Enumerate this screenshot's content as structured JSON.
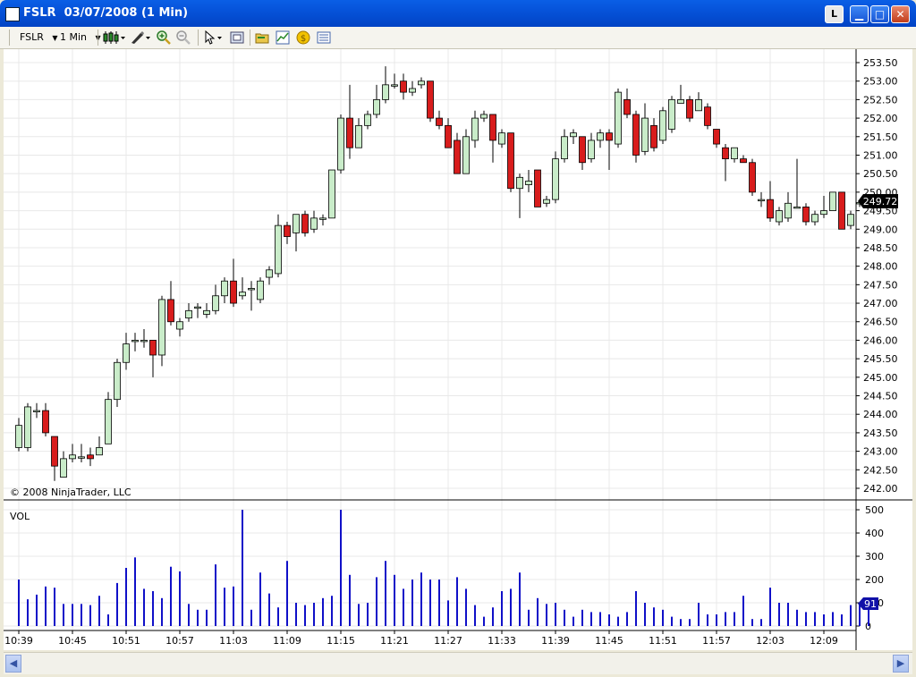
{
  "window": {
    "title": "FSLR  03/07/2008 (1 Min)",
    "link_button": "L"
  },
  "toolbar": {
    "instrument": "FSLR",
    "interval": "1 Min",
    "icons": [
      "candlestick-style-icon",
      "drawing-tool-icon",
      "zoom-in-icon",
      "zoom-out-icon",
      "cursor-icon",
      "data-box-icon",
      "open-folder-icon",
      "indicators-icon",
      "strategy-icon",
      "properties-icon"
    ]
  },
  "chart": {
    "copyright": "© 2008 NinjaTrader, LLC",
    "volume_label": "VOL",
    "last_price": "249.72",
    "last_volume": "91",
    "colors": {
      "up": "#c9ecc9",
      "down": "#d81c1c",
      "volume": "#1010c8",
      "grid": "#e8e8e8",
      "last_price_bg": "#000000",
      "last_volume_bg": "#1010a8"
    }
  },
  "chart_data": [
    {
      "type": "candlestick",
      "title": "FSLR  03/07/2008 (1 Min)",
      "xlabel": "",
      "ylabel": "",
      "ylim": [
        241.8,
        253.7
      ],
      "x_tick_labels": [
        "10:39",
        "10:45",
        "10:51",
        "10:57",
        "11:03",
        "11:09",
        "11:15",
        "11:21",
        "11:27",
        "11:33",
        "11:39",
        "11:45",
        "11:51",
        "11:57",
        "12:03",
        "12:09"
      ],
      "y_tick_labels": [
        "242.00",
        "242.50",
        "243.00",
        "243.50",
        "244.00",
        "244.50",
        "245.00",
        "245.50",
        "246.00",
        "246.50",
        "247.00",
        "247.50",
        "248.00",
        "248.50",
        "249.00",
        "249.50",
        "250.00",
        "250.50",
        "251.00",
        "251.50",
        "252.00",
        "252.50",
        "253.00",
        "253.50"
      ],
      "grid": true,
      "candles": [
        {
          "t": "10:39",
          "o": 243.1,
          "h": 243.9,
          "l": 243.0,
          "c": 243.7
        },
        {
          "t": "10:40",
          "o": 243.1,
          "h": 244.3,
          "l": 243.0,
          "c": 244.2
        },
        {
          "t": "10:41",
          "o": 244.1,
          "h": 244.3,
          "l": 243.9,
          "c": 244.1
        },
        {
          "t": "10:42",
          "o": 244.1,
          "h": 244.3,
          "l": 243.4,
          "c": 243.5
        },
        {
          "t": "10:43",
          "o": 243.4,
          "h": 243.4,
          "l": 242.2,
          "c": 242.6
        },
        {
          "t": "10:44",
          "o": 242.3,
          "h": 243.0,
          "l": 242.3,
          "c": 242.8
        },
        {
          "t": "10:45",
          "o": 242.8,
          "h": 243.2,
          "l": 242.7,
          "c": 242.9
        },
        {
          "t": "10:46",
          "o": 242.85,
          "h": 243.2,
          "l": 242.7,
          "c": 242.85
        },
        {
          "t": "10:47",
          "o": 242.9,
          "h": 243.1,
          "l": 242.6,
          "c": 242.8
        },
        {
          "t": "10:48",
          "o": 242.9,
          "h": 243.4,
          "l": 242.9,
          "c": 243.1
        },
        {
          "t": "10:49",
          "o": 243.2,
          "h": 244.6,
          "l": 243.2,
          "c": 244.4
        },
        {
          "t": "10:50",
          "o": 244.4,
          "h": 245.5,
          "l": 244.2,
          "c": 245.4
        },
        {
          "t": "10:51",
          "o": 245.4,
          "h": 246.2,
          "l": 245.2,
          "c": 245.9
        },
        {
          "t": "10:52",
          "o": 246.0,
          "h": 246.2,
          "l": 245.7,
          "c": 246.0
        },
        {
          "t": "10:53",
          "o": 246.0,
          "h": 246.3,
          "l": 245.8,
          "c": 246.0
        },
        {
          "t": "10:54",
          "o": 246.0,
          "h": 246.0,
          "l": 245.0,
          "c": 245.6
        },
        {
          "t": "10:55",
          "o": 245.6,
          "h": 247.2,
          "l": 245.3,
          "c": 247.1
        },
        {
          "t": "10:56",
          "o": 247.1,
          "h": 247.6,
          "l": 246.4,
          "c": 246.5
        },
        {
          "t": "10:57",
          "o": 246.3,
          "h": 246.6,
          "l": 246.1,
          "c": 246.5
        },
        {
          "t": "10:58",
          "o": 246.6,
          "h": 247.0,
          "l": 246.5,
          "c": 246.8
        },
        {
          "t": "10:59",
          "o": 246.9,
          "h": 247.0,
          "l": 246.6,
          "c": 246.9
        },
        {
          "t": "11:00",
          "o": 246.7,
          "h": 247.0,
          "l": 246.6,
          "c": 246.8
        },
        {
          "t": "11:01",
          "o": 246.8,
          "h": 247.5,
          "l": 246.7,
          "c": 247.2
        },
        {
          "t": "11:02",
          "o": 247.2,
          "h": 247.7,
          "l": 247.0,
          "c": 247.6
        },
        {
          "t": "11:03",
          "o": 247.6,
          "h": 248.2,
          "l": 246.9,
          "c": 247.0
        },
        {
          "t": "11:04",
          "o": 247.2,
          "h": 247.7,
          "l": 247.1,
          "c": 247.3
        },
        {
          "t": "11:05",
          "o": 247.4,
          "h": 247.6,
          "l": 246.8,
          "c": 247.4
        },
        {
          "t": "11:06",
          "o": 247.1,
          "h": 247.7,
          "l": 247.0,
          "c": 247.6
        },
        {
          "t": "11:07",
          "o": 247.7,
          "h": 248.0,
          "l": 247.5,
          "c": 247.9
        },
        {
          "t": "11:08",
          "o": 247.8,
          "h": 249.4,
          "l": 247.7,
          "c": 249.1
        },
        {
          "t": "11:09",
          "o": 249.1,
          "h": 249.2,
          "l": 248.6,
          "c": 248.8
        },
        {
          "t": "11:10",
          "o": 248.9,
          "h": 249.4,
          "l": 248.4,
          "c": 249.4
        },
        {
          "t": "11:11",
          "o": 249.4,
          "h": 249.5,
          "l": 248.8,
          "c": 248.9
        },
        {
          "t": "11:12",
          "o": 249.0,
          "h": 249.5,
          "l": 248.9,
          "c": 249.3
        },
        {
          "t": "11:13",
          "o": 249.3,
          "h": 249.4,
          "l": 249.1,
          "c": 249.3
        },
        {
          "t": "11:14",
          "o": 249.3,
          "h": 250.6,
          "l": 249.3,
          "c": 250.6
        },
        {
          "t": "11:15",
          "o": 250.6,
          "h": 252.1,
          "l": 250.5,
          "c": 252.0
        },
        {
          "t": "11:16",
          "o": 252.0,
          "h": 252.9,
          "l": 250.9,
          "c": 251.2
        },
        {
          "t": "11:17",
          "o": 251.2,
          "h": 252.0,
          "l": 251.2,
          "c": 251.8
        },
        {
          "t": "11:18",
          "o": 251.8,
          "h": 252.2,
          "l": 251.7,
          "c": 252.1
        },
        {
          "t": "11:19",
          "o": 252.1,
          "h": 252.9,
          "l": 252.0,
          "c": 252.5
        },
        {
          "t": "11:20",
          "o": 252.5,
          "h": 253.4,
          "l": 252.4,
          "c": 252.9
        },
        {
          "t": "11:21",
          "o": 252.9,
          "h": 253.2,
          "l": 252.8,
          "c": 252.9
        },
        {
          "t": "11:22",
          "o": 253.0,
          "h": 253.2,
          "l": 252.5,
          "c": 252.7
        },
        {
          "t": "11:23",
          "o": 252.7,
          "h": 253.0,
          "l": 252.6,
          "c": 252.8
        },
        {
          "t": "11:24",
          "o": 252.9,
          "h": 253.1,
          "l": 252.8,
          "c": 253.0
        },
        {
          "t": "11:25",
          "o": 253.0,
          "h": 253.0,
          "l": 251.9,
          "c": 252.0
        },
        {
          "t": "11:26",
          "o": 252.0,
          "h": 252.2,
          "l": 251.7,
          "c": 251.8
        },
        {
          "t": "11:27",
          "o": 251.8,
          "h": 252.0,
          "l": 251.2,
          "c": 251.2
        },
        {
          "t": "11:28",
          "o": 251.4,
          "h": 251.6,
          "l": 250.5,
          "c": 250.5
        },
        {
          "t": "11:29",
          "o": 250.5,
          "h": 251.7,
          "l": 250.5,
          "c": 251.5
        },
        {
          "t": "11:30",
          "o": 251.4,
          "h": 252.2,
          "l": 251.2,
          "c": 252.0
        },
        {
          "t": "11:31",
          "o": 252.0,
          "h": 252.2,
          "l": 251.9,
          "c": 252.1
        },
        {
          "t": "11:32",
          "o": 252.1,
          "h": 252.1,
          "l": 250.8,
          "c": 251.4
        },
        {
          "t": "11:33",
          "o": 251.3,
          "h": 251.7,
          "l": 251.2,
          "c": 251.6
        },
        {
          "t": "11:34",
          "o": 251.6,
          "h": 251.6,
          "l": 250.0,
          "c": 250.1
        },
        {
          "t": "11:35",
          "o": 250.1,
          "h": 250.5,
          "l": 249.3,
          "c": 250.4
        },
        {
          "t": "11:36",
          "o": 250.2,
          "h": 250.6,
          "l": 250.0,
          "c": 250.3
        },
        {
          "t": "11:37",
          "o": 250.6,
          "h": 250.6,
          "l": 249.6,
          "c": 249.6
        },
        {
          "t": "11:38",
          "o": 249.7,
          "h": 249.9,
          "l": 249.6,
          "c": 249.8
        },
        {
          "t": "11:39",
          "o": 249.8,
          "h": 251.1,
          "l": 249.7,
          "c": 250.9
        },
        {
          "t": "11:40",
          "o": 250.9,
          "h": 251.7,
          "l": 250.8,
          "c": 251.5
        },
        {
          "t": "11:41",
          "o": 251.5,
          "h": 251.7,
          "l": 251.3,
          "c": 251.6
        },
        {
          "t": "11:42",
          "o": 251.5,
          "h": 251.5,
          "l": 250.6,
          "c": 250.8
        },
        {
          "t": "11:43",
          "o": 250.9,
          "h": 251.6,
          "l": 250.8,
          "c": 251.4
        },
        {
          "t": "11:44",
          "o": 251.4,
          "h": 251.7,
          "l": 251.2,
          "c": 251.6
        },
        {
          "t": "11:45",
          "o": 251.6,
          "h": 251.7,
          "l": 250.6,
          "c": 251.4
        },
        {
          "t": "11:46",
          "o": 251.3,
          "h": 252.8,
          "l": 251.2,
          "c": 252.7
        },
        {
          "t": "11:47",
          "o": 252.5,
          "h": 252.8,
          "l": 252.0,
          "c": 252.1
        },
        {
          "t": "11:48",
          "o": 252.1,
          "h": 252.2,
          "l": 250.8,
          "c": 251.0
        },
        {
          "t": "11:49",
          "o": 251.1,
          "h": 252.4,
          "l": 251.0,
          "c": 252.0
        },
        {
          "t": "11:50",
          "o": 251.8,
          "h": 252.0,
          "l": 251.1,
          "c": 251.2
        },
        {
          "t": "11:51",
          "o": 251.4,
          "h": 252.3,
          "l": 251.3,
          "c": 252.2
        },
        {
          "t": "11:52",
          "o": 251.7,
          "h": 252.6,
          "l": 251.6,
          "c": 252.5
        },
        {
          "t": "11:53",
          "o": 252.4,
          "h": 252.9,
          "l": 252.4,
          "c": 252.5
        },
        {
          "t": "11:54",
          "o": 252.5,
          "h": 252.6,
          "l": 251.9,
          "c": 252.0
        },
        {
          "t": "11:55",
          "o": 252.2,
          "h": 252.7,
          "l": 252.2,
          "c": 252.5
        },
        {
          "t": "11:56",
          "o": 252.3,
          "h": 252.4,
          "l": 251.7,
          "c": 251.8
        },
        {
          "t": "11:57",
          "o": 251.7,
          "h": 251.7,
          "l": 251.2,
          "c": 251.3
        },
        {
          "t": "11:58",
          "o": 251.2,
          "h": 251.3,
          "l": 250.3,
          "c": 250.9
        },
        {
          "t": "11:59",
          "o": 250.9,
          "h": 251.2,
          "l": 250.8,
          "c": 251.2
        },
        {
          "t": "12:00",
          "o": 250.9,
          "h": 251.0,
          "l": 250.8,
          "c": 250.8
        },
        {
          "t": "12:01",
          "o": 250.8,
          "h": 250.9,
          "l": 249.9,
          "c": 250.0
        },
        {
          "t": "12:02",
          "o": 249.8,
          "h": 250.0,
          "l": 249.6,
          "c": 249.8
        },
        {
          "t": "12:03",
          "o": 249.8,
          "h": 250.3,
          "l": 249.2,
          "c": 249.3
        },
        {
          "t": "12:04",
          "o": 249.2,
          "h": 249.6,
          "l": 249.1,
          "c": 249.5
        },
        {
          "t": "12:05",
          "o": 249.3,
          "h": 250.0,
          "l": 249.2,
          "c": 249.7
        },
        {
          "t": "12:06",
          "o": 249.6,
          "h": 250.9,
          "l": 249.6,
          "c": 249.6
        },
        {
          "t": "12:07",
          "o": 249.6,
          "h": 249.7,
          "l": 249.1,
          "c": 249.2
        },
        {
          "t": "12:08",
          "o": 249.2,
          "h": 249.5,
          "l": 249.1,
          "c": 249.4
        },
        {
          "t": "12:09",
          "o": 249.4,
          "h": 249.9,
          "l": 249.3,
          "c": 249.5
        },
        {
          "t": "12:10",
          "o": 249.5,
          "h": 250.0,
          "l": 249.5,
          "c": 250.0
        },
        {
          "t": "12:11",
          "o": 250.0,
          "h": 250.0,
          "l": 249.0,
          "c": 249.0
        },
        {
          "t": "12:12",
          "o": 249.1,
          "h": 249.5,
          "l": 249.0,
          "c": 249.4
        },
        {
          "t": "12:13",
          "o": 249.7,
          "h": 249.8,
          "l": 249.6,
          "c": 249.72
        }
      ]
    },
    {
      "type": "bar",
      "title": "VOL",
      "ylim": [
        0,
        520
      ],
      "y_tick_labels": [
        "0",
        "100",
        "200",
        "300",
        "400",
        "500"
      ],
      "grid": true,
      "volumes": [
        200,
        115,
        135,
        170,
        165,
        95,
        95,
        95,
        90,
        130,
        50,
        185,
        250,
        295,
        160,
        150,
        120,
        255,
        235,
        95,
        70,
        70,
        265,
        165,
        170,
        500,
        70,
        230,
        140,
        80,
        280,
        100,
        90,
        100,
        120,
        130,
        500,
        220,
        95,
        100,
        210,
        280,
        220,
        160,
        200,
        230,
        200,
        200,
        110,
        210,
        160,
        90,
        40,
        80,
        150,
        160,
        230,
        70,
        120,
        95,
        100,
        70,
        40,
        70,
        60,
        60,
        50,
        40,
        60,
        150,
        100,
        80,
        70,
        40,
        30,
        30,
        100,
        50,
        50,
        60,
        60,
        130,
        30,
        30,
        165,
        100,
        100,
        70,
        60,
        60,
        50,
        60,
        50,
        90,
        95,
        91
      ]
    }
  ]
}
